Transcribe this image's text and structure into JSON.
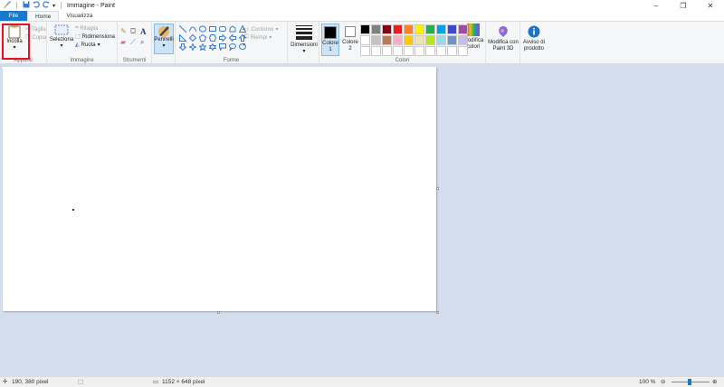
{
  "window": {
    "title": "Immagine - Paint"
  },
  "tabs": [
    {
      "label": "File"
    },
    {
      "label": "Home"
    },
    {
      "label": "Visualizza"
    }
  ],
  "ribbon": {
    "clipboard": {
      "label": "Appunti",
      "paste": "Incolla",
      "cut": "Taglia",
      "copy": "Copia"
    },
    "image": {
      "label": "Immagine",
      "select": "Seleziona",
      "crop": "Ritaglia",
      "resize": "Ridimensiona",
      "rotate": "Ruota"
    },
    "tools": {
      "label": "Strumenti"
    },
    "brushes": {
      "label": "Pennelli"
    },
    "shapes": {
      "label": "Forme",
      "outline": "Contorno",
      "fill": "Riempi"
    },
    "size": {
      "label": "Dimensioni"
    },
    "colors": {
      "label": "Colori",
      "color1": "Colore 1",
      "color2": "Colore 2",
      "edit": "Modifica colori",
      "row1": [
        "#000000",
        "#7f7f7f",
        "#880015",
        "#ed1c24",
        "#ff7f27",
        "#fff200",
        "#22b14c",
        "#00a2e8",
        "#3f48cc",
        "#a349a4"
      ],
      "row2": [
        "#ffffff",
        "#c3c3c3",
        "#b97a57",
        "#ffaec9",
        "#ffc90e",
        "#efe4b0",
        "#b5e61d",
        "#99d9ea",
        "#7092be",
        "#c8bfe7"
      ]
    },
    "paint3d": {
      "label": "Modifica con Paint 3D"
    },
    "feedback": {
      "label": "Avviso di prodotto"
    }
  },
  "status": {
    "cursor": "190, 380 pixel",
    "size": "1152 × 648 pixel",
    "zoom": "100 %"
  },
  "icons": [
    "save-icon",
    "undo-icon",
    "redo-icon",
    "paste-icon",
    "select-icon",
    "crop-icon",
    "resize-icon",
    "rotate-icon",
    "pencil-icon",
    "fill-icon",
    "text-icon",
    "eraser-icon",
    "color-picker-icon",
    "magnifier-icon",
    "brush-icon",
    "size-icon",
    "paint3d-icon",
    "info-icon",
    "cursor-pos-icon",
    "selection-size-icon",
    "canvas-size-icon"
  ]
}
